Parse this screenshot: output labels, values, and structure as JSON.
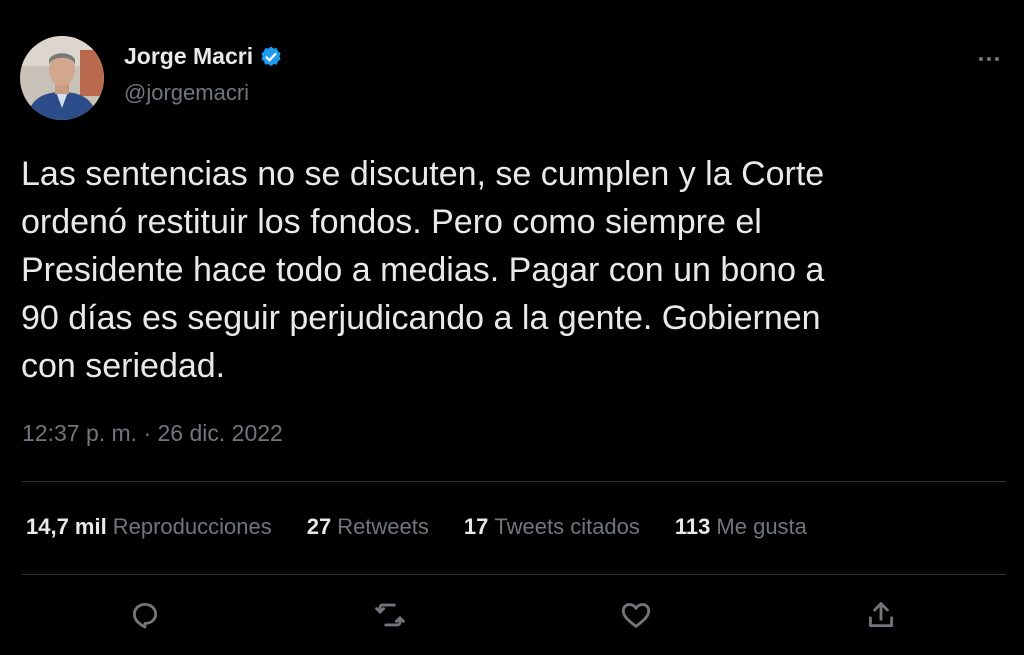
{
  "tweet": {
    "author": {
      "name": "Jorge Macri",
      "handle": "@jorgemacri"
    },
    "text": "Las sentencias no se discuten, se cumplen y la Corte\nordenó restituir los fondos. Pero como siempre el\nPresidente hace todo a medias. Pagar con un bono a\n90 días es seguir perjudicando a la gente. Gobiernen\ncon seriedad.",
    "timestamp": "12:37 p. m. · 26 dic. 2022",
    "stats": {
      "views": {
        "count": "14,7 mil",
        "label": "Reproducciones"
      },
      "retweets": {
        "count": "27",
        "label": "Retweets"
      },
      "quotes": {
        "count": "17",
        "label": "Tweets citados"
      },
      "likes": {
        "count": "113",
        "label": "Me gusta"
      }
    }
  },
  "icons": {
    "verified": "verified-badge-icon",
    "more": "more-icon",
    "reply": "reply-icon",
    "retweet": "retweet-icon",
    "like": "like-icon",
    "share": "share-icon"
  },
  "colors": {
    "background": "#000000",
    "text": "#e7e9ea",
    "secondary": "#71767b",
    "divider": "#2f3336",
    "verified": "#1d9bf0"
  }
}
